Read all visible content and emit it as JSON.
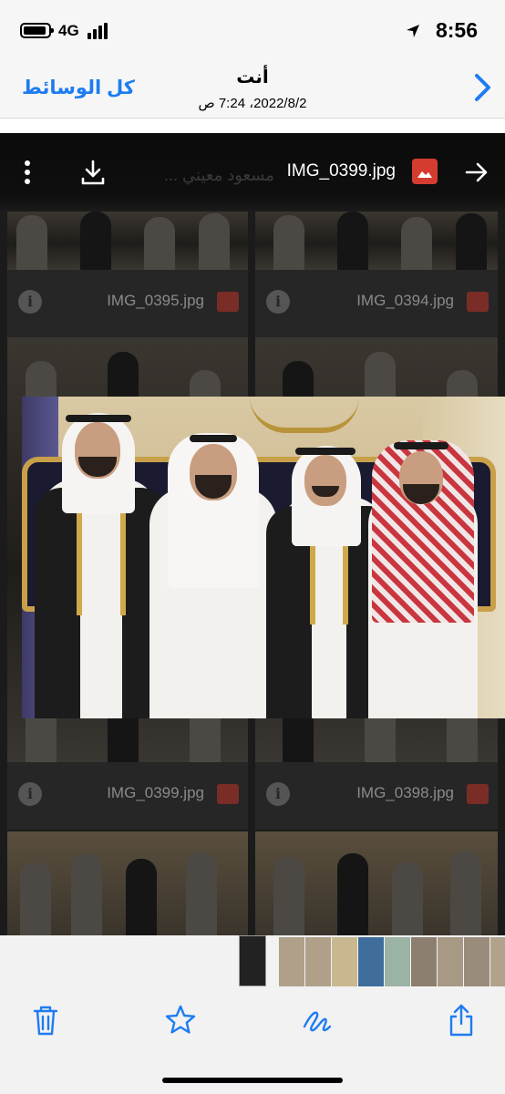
{
  "status_bar": {
    "network": "4G",
    "time": "8:56"
  },
  "header": {
    "title": "أنت",
    "subtitle": "2022/8/2، 7:24 ص",
    "all_media_label": "كل الوسائط"
  },
  "viewer": {
    "file_name": "IMG_0399.jpg",
    "faded_title": "... مسعود معيني",
    "grid_captions": [
      {
        "name": "IMG_0395.jpg"
      },
      {
        "name": "IMG_0394.jpg"
      },
      {
        "name": "IMG_0399.jpg"
      },
      {
        "name": "IMG_0398.jpg"
      }
    ],
    "info_glyph": "i"
  },
  "colors": {
    "accent": "#1e7cf2",
    "viewer_bg": "#1b1b1b",
    "photo_icon": "#d43c2f"
  },
  "icons": {
    "back": "chevron-right-icon",
    "location": "location-arrow-icon",
    "arrow": "arrow-right-icon",
    "photo": "photo-icon",
    "download": "download-icon",
    "more": "more-vertical-icon",
    "delete": "trash-icon",
    "favorite": "star-icon",
    "markup": "markup-icon",
    "share": "share-icon"
  }
}
